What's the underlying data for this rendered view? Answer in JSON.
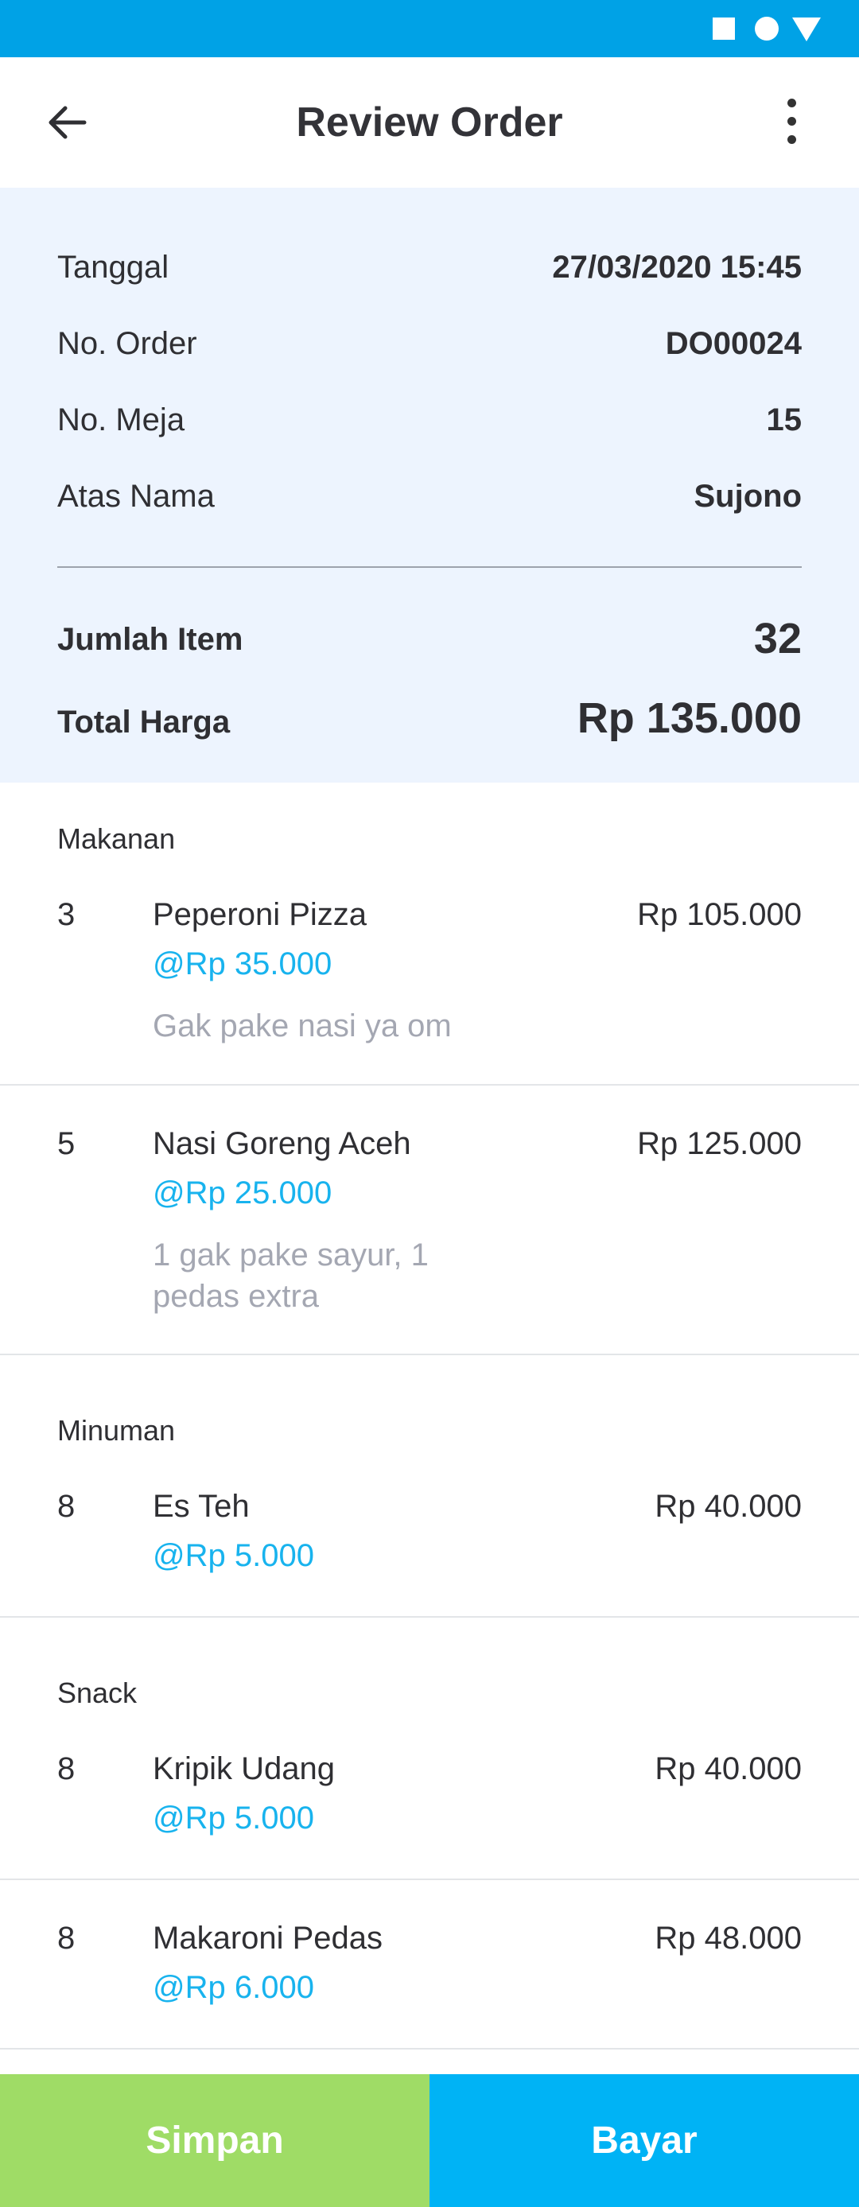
{
  "header": {
    "title": "Review Order"
  },
  "summary": {
    "rows": [
      {
        "label": "Tanggal",
        "value": "27/03/2020 15:45"
      },
      {
        "label": "No. Order",
        "value": "DO00024"
      },
      {
        "label": "No. Meja",
        "value": "15"
      },
      {
        "label": "Atas Nama",
        "value": "Sujono"
      }
    ],
    "item_count_label": "Jumlah Item",
    "item_count": "32",
    "total_label": "Total Harga",
    "total": "Rp 135.000"
  },
  "sections": [
    {
      "title": "Makanan",
      "items": [
        {
          "qty": "3",
          "name": "Peperoni Pizza",
          "unit_price": "@Rp 35.000",
          "note": "Gak pake nasi ya om",
          "price": "Rp 105.000"
        },
        {
          "qty": "5",
          "name": "Nasi Goreng Aceh",
          "unit_price": "@Rp 25.000",
          "note": "1 gak pake sayur, 1 pedas extra",
          "price": "Rp 125.000"
        }
      ]
    },
    {
      "title": "Minuman",
      "items": [
        {
          "qty": "8",
          "name": "Es Teh",
          "unit_price": "@Rp 5.000",
          "price": "Rp 40.000"
        }
      ]
    },
    {
      "title": "Snack",
      "items": [
        {
          "qty": "8",
          "name": "Kripik Udang",
          "unit_price": "@Rp 5.000",
          "price": "Rp 40.000"
        },
        {
          "qty": "8",
          "name": "Makaroni Pedas",
          "unit_price": "@Rp 6.000",
          "price": "Rp 48.000"
        }
      ]
    }
  ],
  "footer": {
    "save_label": "Simpan",
    "pay_label": "Bayar"
  },
  "colors": {
    "status_bar": "#00a2e6",
    "summary_bg": "#edf4fe",
    "accent_blue": "#18b3ee",
    "save_green": "#9fdc66",
    "pay_blue": "#00b3f5"
  },
  "icons": [
    "back-arrow-icon",
    "more-vert-icon",
    "status-square-icon",
    "status-circle-icon",
    "status-triangle-icon"
  ]
}
